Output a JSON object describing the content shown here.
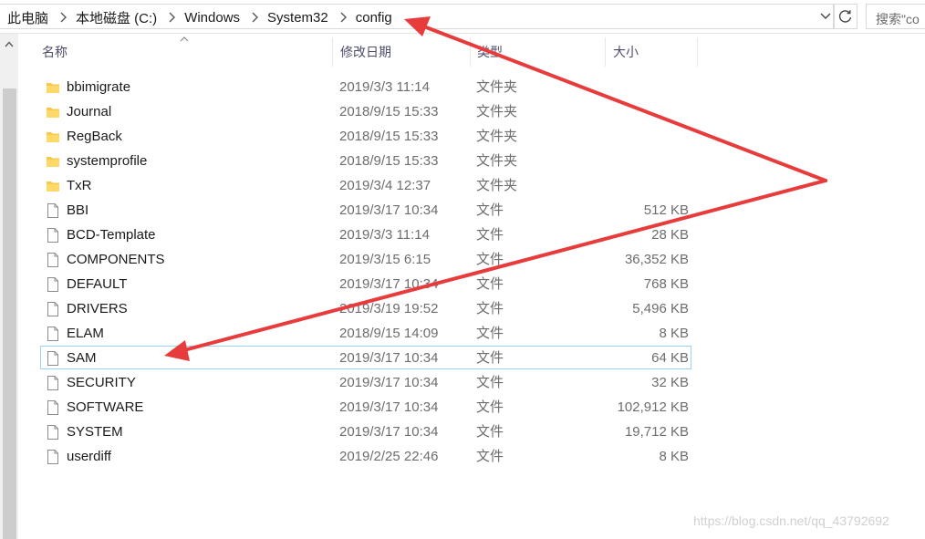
{
  "address": {
    "crumbs": [
      "此电脑",
      "本地磁盘 (C:)",
      "Windows",
      "System32",
      "config"
    ],
    "search_placeholder": "搜索\"co"
  },
  "columns": {
    "name": "名称",
    "date": "修改日期",
    "type": "类型",
    "size": "大小"
  },
  "files": [
    {
      "name": "bbimigrate",
      "date": "2019/3/3 11:14",
      "type": "文件夹",
      "size": "",
      "kind": "folder"
    },
    {
      "name": "Journal",
      "date": "2018/9/15 15:33",
      "type": "文件夹",
      "size": "",
      "kind": "folder"
    },
    {
      "name": "RegBack",
      "date": "2018/9/15 15:33",
      "type": "文件夹",
      "size": "",
      "kind": "folder"
    },
    {
      "name": "systemprofile",
      "date": "2018/9/15 15:33",
      "type": "文件夹",
      "size": "",
      "kind": "folder"
    },
    {
      "name": "TxR",
      "date": "2019/3/4 12:37",
      "type": "文件夹",
      "size": "",
      "kind": "folder"
    },
    {
      "name": "BBI",
      "date": "2019/3/17 10:34",
      "type": "文件",
      "size": "512 KB",
      "kind": "file"
    },
    {
      "name": "BCD-Template",
      "date": "2019/3/3 11:14",
      "type": "文件",
      "size": "28 KB",
      "kind": "file"
    },
    {
      "name": "COMPONENTS",
      "date": "2019/3/15 6:15",
      "type": "文件",
      "size": "36,352 KB",
      "kind": "file"
    },
    {
      "name": "DEFAULT",
      "date": "2019/3/17 10:34",
      "type": "文件",
      "size": "768 KB",
      "kind": "file"
    },
    {
      "name": "DRIVERS",
      "date": "2019/3/19 19:52",
      "type": "文件",
      "size": "5,496 KB",
      "kind": "file"
    },
    {
      "name": "ELAM",
      "date": "2018/9/15 14:09",
      "type": "文件",
      "size": "8 KB",
      "kind": "file"
    },
    {
      "name": "SAM",
      "date": "2019/3/17 10:34",
      "type": "文件",
      "size": "64 KB",
      "kind": "file",
      "selected": true
    },
    {
      "name": "SECURITY",
      "date": "2019/3/17 10:34",
      "type": "文件",
      "size": "32 KB",
      "kind": "file"
    },
    {
      "name": "SOFTWARE",
      "date": "2019/3/17 10:34",
      "type": "文件",
      "size": "102,912 KB",
      "kind": "file"
    },
    {
      "name": "SYSTEM",
      "date": "2019/3/17 10:34",
      "type": "文件",
      "size": "19,712 KB",
      "kind": "file"
    },
    {
      "name": "userdiff",
      "date": "2019/2/25 22:46",
      "type": "文件",
      "size": "8 KB",
      "kind": "file"
    }
  ],
  "watermark": "https://blog.csdn.net/qq_43792692",
  "colors": {
    "folder": "#f7c948",
    "selection_border": "#99d1ff",
    "annotation_arrow": "#e83b3b"
  }
}
